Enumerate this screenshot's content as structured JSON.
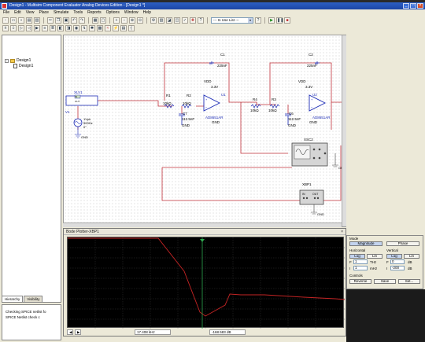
{
  "window": {
    "title": "Design1 - Multisim Component Evaluator Analog Devices Edition - [Design1 *]",
    "controls": [
      "_",
      "□",
      "×"
    ]
  },
  "menu": [
    "File",
    "Edit",
    "View",
    "Place",
    "Simulate",
    "Tools",
    "Reports",
    "Options",
    "Window",
    "Help"
  ],
  "toolbar": {
    "in_use_list": "--- In Use List ---",
    "run": "▶",
    "pause": "❚❚",
    "stop": "■"
  },
  "design_toolbox": {
    "root": "Design1",
    "child": "Design1"
  },
  "panel_tabs": [
    "Hierarchy",
    "Visibility"
  ],
  "output": {
    "lines": [
      "Checking SPICE netlist fo",
      "SPICE Netlist check c"
    ]
  },
  "schematic": {
    "xlv": "XLV1",
    "in": "IN",
    "out": "OUT",
    "v1": {
      "name": "V1",
      "amp": "1Vpk",
      "freq": "500Hz",
      "phase": "0°"
    },
    "gnd": "GND",
    "stage1": {
      "r1": "R1",
      "r1v": "10kΩ",
      "r2": "R2",
      "r2v": "10kΩ",
      "c1": "C1",
      "c1v": "225nF",
      "c7": "C7",
      "c7v": "112.5nF",
      "vdd": "VDD",
      "vddv": "3.3V",
      "u": "U1",
      "part": "AD8651AR"
    },
    "stage2": {
      "r4": "R4",
      "r4v": "10kΩ",
      "r3": "R3",
      "r3v": "10kΩ",
      "c2": "C2",
      "c2v": "225nF",
      "c6": "C6",
      "c6v": "112.5nF",
      "vdd": "VDD",
      "vddv": "3.3V",
      "u": "U2",
      "part": "AD8651AR"
    },
    "xsc": "XSC2",
    "xbp": "XBP1"
  },
  "bode": {
    "title": "Bode Plotter-XBP1",
    "close": "×",
    "readout_freq": "17.408 kHz",
    "readout_mag": "-168.583 dB",
    "controls": {
      "mode": "Mode",
      "magnitude": "Magnitude",
      "phase": "Phase",
      "horizontal": "Horizontal",
      "vertical": "Vertical",
      "log": "Log",
      "lin": "Lin",
      "h_f": "F",
      "h_f_val": "1",
      "h_f_unit": "THz",
      "h_i": "I",
      "h_i_val": "1",
      "h_i_unit": "mHz",
      "v_f": "F",
      "v_f_val": "0",
      "v_f_unit": "dB",
      "v_i": "I",
      "v_i_val": "-200",
      "v_i_unit": "dB",
      "controls": "Controls",
      "reverse": "Reverse",
      "save": "Save",
      "set": "Set..."
    }
  },
  "colors": {
    "wire": "#c0303a",
    "component": "#1b2bb5",
    "titlebar": "#1c44a5",
    "trace": "#c42424",
    "cursor": "#2fa84f"
  }
}
